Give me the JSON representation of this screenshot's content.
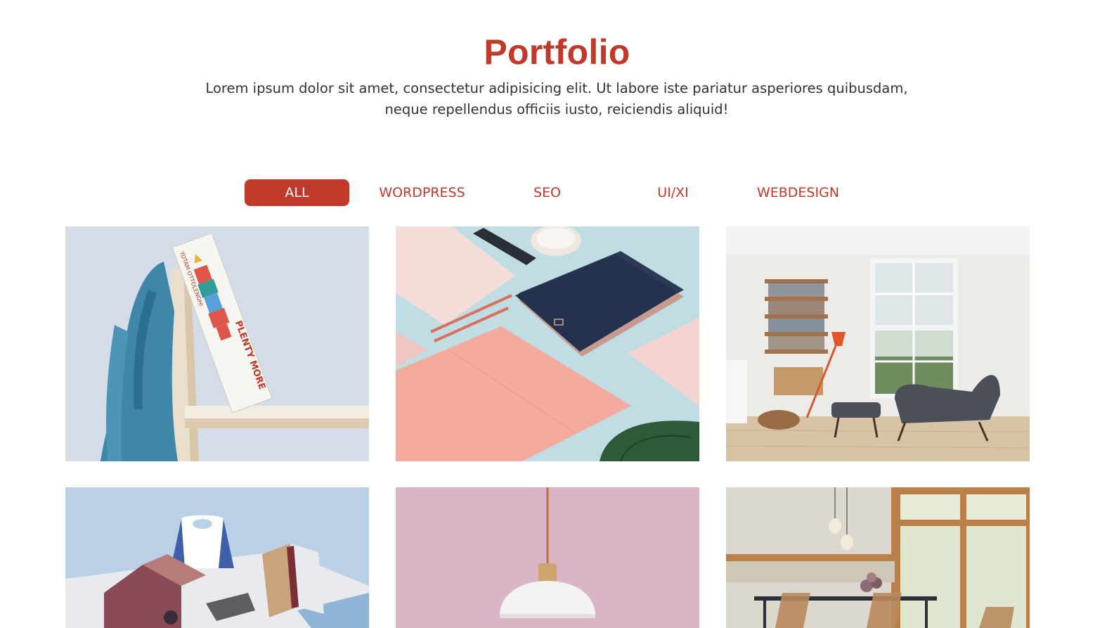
{
  "header": {
    "title": "Portfolio",
    "intro_line1": "Lorem ipsum dolor sit amet, consectetur adipisicing elit. Ut labore iste pariatur asperiores quibusdam,",
    "intro_line2": "neque repellendus officiis iusto, reiciendis aliquid!"
  },
  "filters": [
    {
      "label": "ALL",
      "active": true
    },
    {
      "label": "WORDPRESS",
      "active": false
    },
    {
      "label": "SEO",
      "active": false
    },
    {
      "label": "UI/XI",
      "active": false
    },
    {
      "label": "WEBDESIGN",
      "active": false
    }
  ],
  "portfolio": {
    "book_spine_author": "YOTAM OTTOLENGHI",
    "book_spine_title": "PLENTY MORE"
  },
  "colors": {
    "accent": "#c0392b",
    "text": "#333333",
    "background": "#ffffff"
  }
}
